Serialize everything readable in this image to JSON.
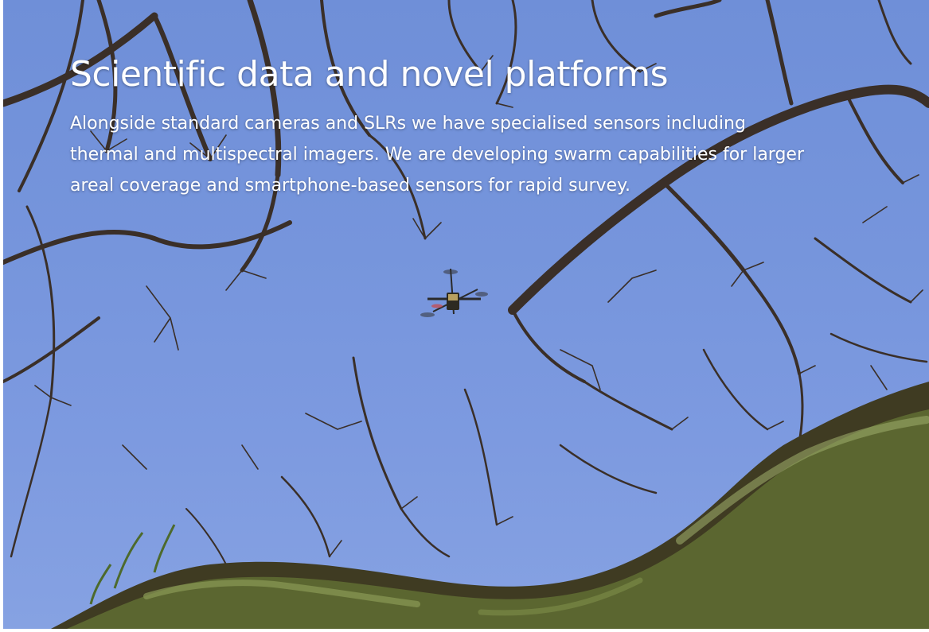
{
  "photo": {
    "heading": "Scientific data and novel platforms",
    "body": "Alongside standard cameras and SLRs we have specialised sensors including thermal and multispectral imagers. We are developing swarm capabilities for larger areal coverage and smartphone-based sensors for rapid survey."
  },
  "colors": {
    "sky": "#7695dc",
    "branch": "#3a2f28",
    "moss": "#6b7a3c",
    "text": "#ffffff"
  },
  "icons": {
    "subject": "quadcopter-drone-icon"
  }
}
